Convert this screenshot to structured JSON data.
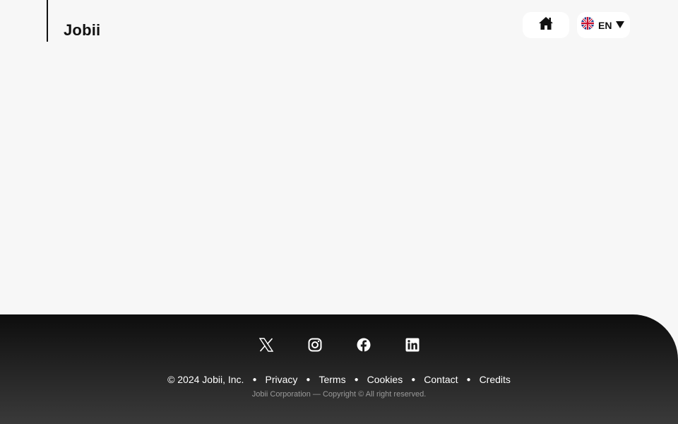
{
  "header": {
    "logo_text": "Jobii",
    "language": {
      "code": "EN",
      "flag_icon": "uk-flag-icon"
    },
    "home_icon": "home-icon"
  },
  "footer": {
    "socials": [
      {
        "name": "x-icon"
      },
      {
        "name": "instagram-icon"
      },
      {
        "name": "facebook-icon"
      },
      {
        "name": "linkedin-icon"
      }
    ],
    "copyright": "© 2024 Jobii, Inc.",
    "links": [
      "Privacy",
      "Terms",
      "Cookies",
      "Contact",
      "Credits"
    ],
    "subtext": "Jobii Corporation — Copyright © All right reserved."
  },
  "colors": {
    "background": "#f7f7f7",
    "footer": "#1c1c1c",
    "text_dark": "#111111"
  }
}
